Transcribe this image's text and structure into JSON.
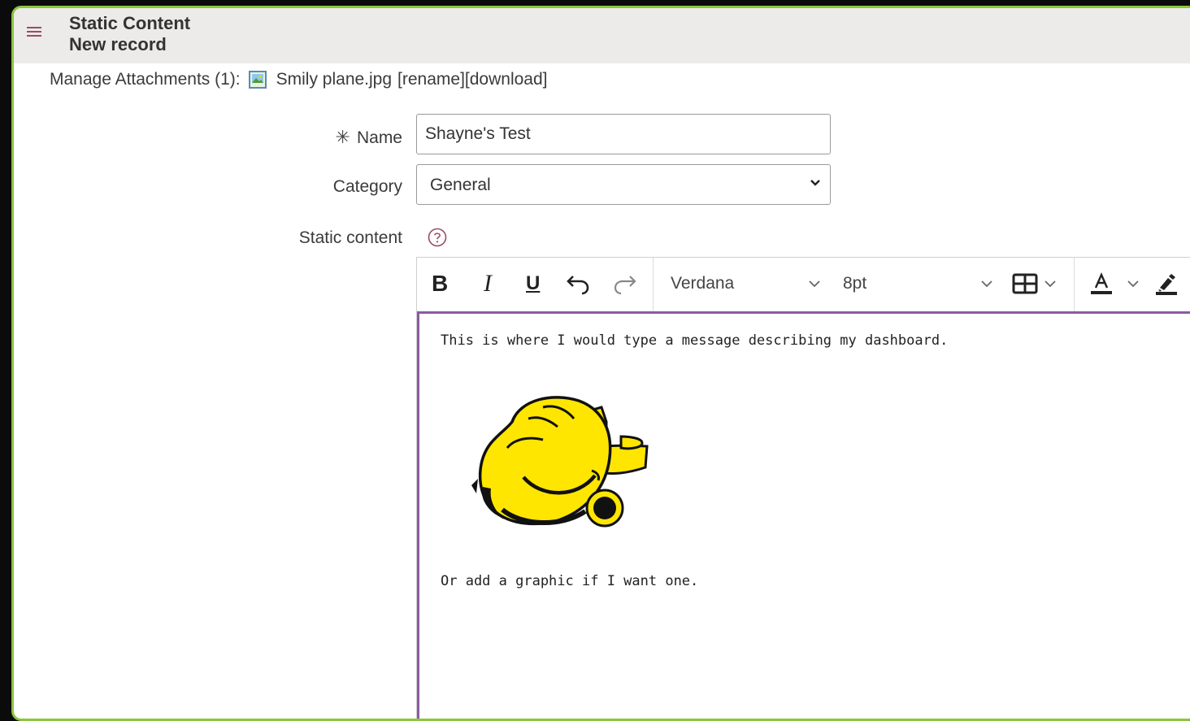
{
  "header": {
    "title": "Static Content",
    "subtitle": "New record"
  },
  "attachments": {
    "label": "Manage Attachments (1):",
    "file_name": "Smily plane.jpg",
    "rename_link": "[rename]",
    "download_link": "[download]"
  },
  "form": {
    "name_label": "Name",
    "name_required_mark": "✳",
    "name_value": "Shayne's Test",
    "category_label": "Category",
    "category_value": "General",
    "static_content_label": "Static content"
  },
  "editor": {
    "toolbar": {
      "bold": "B",
      "italic": "I",
      "underline": "U",
      "font_family": "Verdana",
      "font_size": "8pt"
    },
    "content": {
      "line1": "This is where I would type a message describing my dashboard.",
      "line2": "Or add a graphic if I want one."
    },
    "accent_color": "#8c5aa5"
  },
  "colors": {
    "frame_border": "#8bc53f",
    "header_bg": "#ecebe9",
    "hamburger": "#9b4a69"
  }
}
